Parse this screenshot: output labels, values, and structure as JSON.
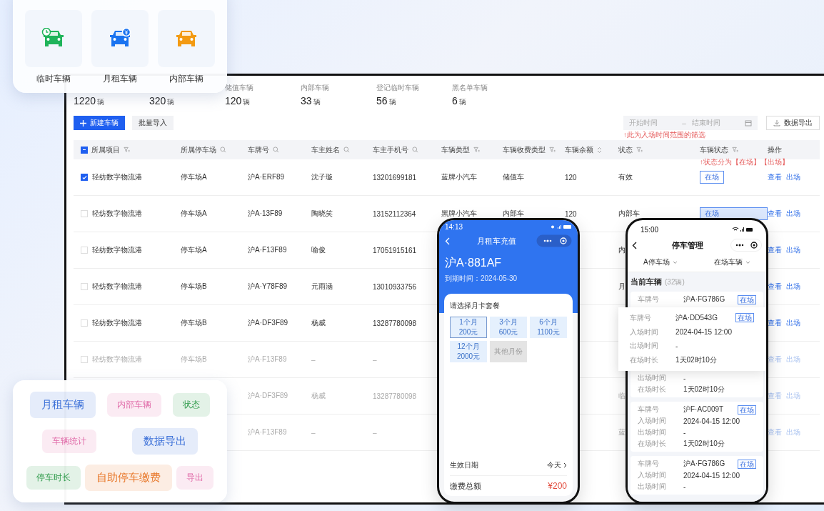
{
  "top_card": {
    "tiles": [
      {
        "kind": "temporary",
        "label": "临时车辆"
      },
      {
        "kind": "monthly",
        "label": "月租车辆"
      },
      {
        "kind": "internal",
        "label": "内部车辆"
      }
    ]
  },
  "stats": [
    {
      "value": "1220",
      "unit": "辆"
    },
    {
      "value": "320",
      "unit": "辆"
    },
    {
      "label": "储值车辆",
      "value": "120",
      "unit": "辆"
    },
    {
      "label": "内部车辆",
      "value": "33",
      "unit": "辆"
    },
    {
      "label": "登记临时车辆",
      "value": "56",
      "unit": "辆"
    },
    {
      "label": "黑名单车辆",
      "value": "6",
      "unit": "辆"
    }
  ],
  "toolbar": {
    "new_button": "新建车辆",
    "import_button": "批量导入",
    "start_placeholder": "开始时间",
    "separator": "–",
    "end_placeholder": "结束时间",
    "date_hint": "↑此为入场时间范围的筛选",
    "export_button": "数据导出"
  },
  "table": {
    "header_indeterminate": true,
    "status_hint": "↑状态分为【在场】【出场】",
    "columns": [
      {
        "label": "所属项目",
        "kind": "filter"
      },
      {
        "label": "所属停车场",
        "kind": "search"
      },
      {
        "label": "车牌号",
        "kind": "search"
      },
      {
        "label": "车主姓名",
        "kind": "search"
      },
      {
        "label": "车主手机号",
        "kind": "search"
      },
      {
        "label": "车辆类型",
        "kind": "filter"
      },
      {
        "label": "车辆收费类型",
        "kind": "filter"
      },
      {
        "label": "车辆余额",
        "kind": "sort"
      },
      {
        "label": "状态",
        "kind": "filter"
      },
      {
        "label": "车辆状态",
        "kind": "filter"
      },
      {
        "label": "操作",
        "kind": "plain"
      }
    ],
    "rows": [
      {
        "checked": true,
        "dimmed": false,
        "project": "轻纺数字物流港",
        "lot": "停车场A",
        "plate": "沪A·ERF89",
        "owner": "沈子璇",
        "phone": "13201699181",
        "type": "蓝牌小汽车",
        "fee_type": "储值车",
        "balance": "120",
        "status": "有效",
        "vehicle_status": "在场",
        "actions": [
          "查看",
          "出场"
        ]
      },
      {
        "checked": false,
        "dimmed": false,
        "project": "轻纺数字物流港",
        "lot": "停车场A",
        "plate": "沪A·13F89",
        "owner": "陶晓笑",
        "phone": "13152112364",
        "type": "黑牌小汽车",
        "fee_type": "内部车",
        "balance": "120",
        "status": "内部车",
        "vehicle_status": "在场",
        "actions": [
          "查看",
          "出场"
        ]
      },
      {
        "checked": false,
        "dimmed": false,
        "project": "轻纺数字物流港",
        "lot": "停车场A",
        "plate": "沪A·F13F89",
        "owner": "喻俊",
        "phone": "17051915161",
        "status": "内",
        "actions": [
          "查看",
          "出场"
        ]
      },
      {
        "checked": false,
        "dimmed": false,
        "project": "轻纺数字物流港",
        "lot": "停车场B",
        "plate": "沪A·Y78F89",
        "owner": "元雨涵",
        "phone": "13010933756",
        "status": "月",
        "actions": [
          "查看",
          "出场"
        ]
      },
      {
        "checked": false,
        "dimmed": false,
        "project": "轻纺数字物流港",
        "lot": "停车场B",
        "plate": "沪A·DF3F89",
        "owner": "杨威",
        "phone": "13287780098",
        "actions": [
          "查看",
          "出场"
        ]
      },
      {
        "checked": false,
        "dimmed": true,
        "project": "轻纺数字物流港",
        "lot": "停车场B",
        "plate": "沪A·F13F89",
        "owner": "–",
        "phone": "–",
        "actions": [
          "查看",
          "出场"
        ]
      },
      {
        "dimmed": true,
        "plate": "沪A·DF3F89",
        "owner": "杨威",
        "phone": "13287780098",
        "status": "临",
        "actions": [
          "查看",
          "出场"
        ]
      },
      {
        "dimmed": true,
        "plate": "沪A·F13F89",
        "owner": "–",
        "phone": "–",
        "status": "蓝",
        "actions": [
          "查看",
          "出场"
        ]
      }
    ]
  },
  "tag_card": {
    "rows": [
      [
        {
          "text": "月租车辆",
          "color": "#3a6fd8",
          "kind": "large"
        },
        {
          "text": "内部车辆",
          "color": "#e06aa8",
          "kind": "small"
        },
        {
          "text": "状态",
          "color": "#2e9a4a",
          "kind": "small"
        }
      ],
      [
        {
          "text": "车辆统计",
          "color": "#e06aa8",
          "kind": "small"
        },
        {
          "text": "数据导出",
          "color": "#3a6fd8",
          "kind": "large"
        }
      ],
      [
        {
          "text": "停车时长",
          "color": "#2e9a4a",
          "kind": "small"
        },
        {
          "text": "自助停车缴费",
          "color": "#e8782a",
          "kind": "large"
        },
        {
          "text": "导出",
          "color": "#e06aa8",
          "kind": "small"
        }
      ]
    ]
  },
  "phone_recharge": {
    "time": "14:13",
    "title": "月租车充值",
    "plate": "沪A·881AF",
    "expiry": "到期时间：2024-05-30",
    "prompt": "请选择月卡套餐",
    "options": [
      {
        "period": "1个月",
        "price": "200元",
        "selected": true,
        "disabled": false
      },
      {
        "period": "3个月",
        "price": "600元",
        "selected": false,
        "disabled": false
      },
      {
        "period": "6个月",
        "price": "1100元",
        "selected": false,
        "disabled": false
      },
      {
        "period": "12个月",
        "price": "2000元",
        "selected": false,
        "disabled": false
      },
      {
        "period": "其他月份",
        "selected": false,
        "disabled": true
      }
    ],
    "effective_label": "生效日期",
    "effective_value": "今天",
    "total_label": "缴费总额",
    "total_value": "¥200"
  },
  "phone_parking": {
    "time": "15:00",
    "title": "停车管理",
    "lot_filter": "A停车场",
    "status_filter": "在场车辆",
    "section": "当前车辆",
    "count": "(32辆)",
    "cards": [
      {
        "badge": "在场",
        "fields": [
          {
            "label": "车牌号",
            "value": "沪A·FG786G"
          },
          {
            "label": "出场时间",
            "value": "-"
          },
          {
            "label": "在场时长",
            "value": "1天02时10分"
          }
        ]
      },
      {
        "badge": "在场",
        "fields": [
          {
            "label": "车牌号",
            "value": "沪F·AC009T"
          },
          {
            "label": "入场时间",
            "value": "2024-04-15 12:00"
          },
          {
            "label": "出场时间",
            "value": "-"
          },
          {
            "label": "在场时长",
            "value": "1天02时10分"
          }
        ]
      },
      {
        "badge": "在场",
        "fields": [
          {
            "label": "车牌号",
            "value": "沪A·FG786G"
          },
          {
            "label": "入场时间",
            "value": "2024-04-15 12:00"
          },
          {
            "label": "出场时间",
            "value": "-"
          }
        ]
      }
    ]
  },
  "popup_card": {
    "badge": "在场",
    "fields": [
      {
        "label": "车牌号",
        "value": "沪A·DD543G"
      },
      {
        "label": "入场时间",
        "value": "2024-04-15 12:00"
      },
      {
        "label": "出场时间",
        "value": "-"
      },
      {
        "label": "在场时长",
        "value": "1天02时10分"
      }
    ]
  }
}
